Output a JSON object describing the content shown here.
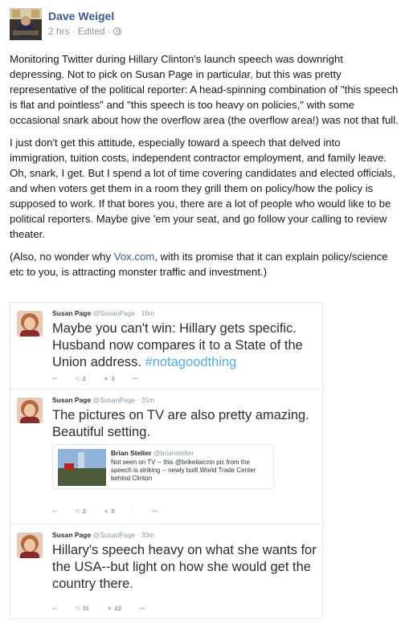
{
  "post": {
    "author": "Dave Weigel",
    "time": "2 hrs",
    "edited": "Edited",
    "paragraphs": [
      "Monitoring Twitter during Hillary Clinton's launch speech was downright depressing. Not to pick on Susan Page in particular, but this was pretty representative of the political reporter: A head-spinning combination of \"this speech is flat and pointless\" and \"this speech is too heavy on policies,\" with some occasional snark about how the overflow area (the overflow area!) was not that full.",
      "I just don't get this attitude, especially toward a speech that delved into immigration, tuition costs, independent contractor employment, and family leave. Oh, snark, I get. But I spend a lot of time covering candidates and elected officials, and when voters get them in a room they grill them on policy/how the policy is supposed to work. If that bores you, there are a lot of people who would like to be political reporters. Maybe give 'em your seat, and go follow your calling to review theater."
    ],
    "p3_before": "(Also, no wonder why ",
    "p3_link": "Vox.com",
    "p3_after": ", with its promise that it can explain policy/science etc to you, is attracting monster traffic and investment.)"
  },
  "tweets": [
    {
      "name": "Susan Page",
      "handle": "@SusanPage",
      "time": "· 16m",
      "text": "Maybe you can't win: Hillary gets specific. Husband now compares it to a State of the Union address. ",
      "hashtag": "#notagoodthing",
      "retweets": "2",
      "favorites": "3"
    },
    {
      "name": "Susan Page",
      "handle": "@SusanPage",
      "time": "· 31m",
      "text": "The pictures on TV are also pretty amazing. Beautiful setting.",
      "retweets": "2",
      "favorites": "5",
      "quote": {
        "name": "Brian Stelter",
        "handle": "@brianstelter",
        "text": "Not seen on TV -- this @brikeilarcnn pic from the speech is striking -- newly built World Trade Center behind Clinton"
      }
    },
    {
      "name": "Susan Page",
      "handle": "@SusanPage",
      "time": "· 33m",
      "text": "Hillary's speech heavy on what she wants for the USA--but light on how she would get the country there.",
      "retweets": "31",
      "favorites": "22"
    }
  ],
  "icons": {
    "reply": "↩",
    "retweet": "⟲",
    "favorite": "★",
    "more": "•••",
    "pin": "⫶"
  }
}
